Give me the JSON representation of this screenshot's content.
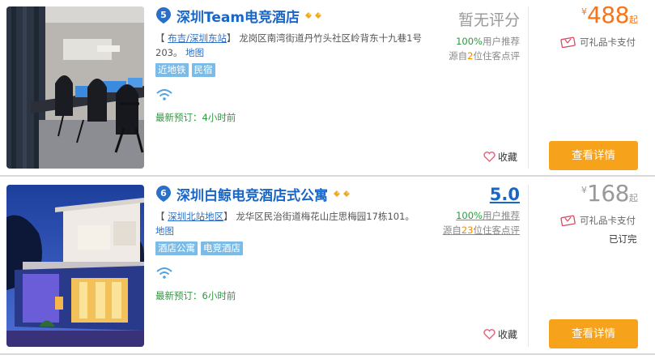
{
  "hotels": [
    {
      "number": "5",
      "name": "深圳Team电竞酒店",
      "address_prefix": "【",
      "area": "布吉/深圳东站",
      "address_suffix": "】",
      "address": "龙岗区南湾街道丹竹头社区岭背东十九巷1号203。",
      "map_label": "地图",
      "tags": [
        "近地铁",
        "民宿"
      ],
      "recent_booking": "最新预订：4小时前",
      "score_text": "暂无评分",
      "recommend_pct": "100%",
      "recommend_text": "用户推荐",
      "reviews_prefix": "源自",
      "reviews_count": "2",
      "reviews_suffix": "位住客点评",
      "favorite_label": "收藏",
      "price_currency": "¥",
      "price": "488",
      "price_suffix": "起",
      "gift_card": "可礼品卡支付",
      "booked": "",
      "detail_button": "查看详情"
    },
    {
      "number": "6",
      "name": "深圳白鲸电竞酒店式公寓",
      "address_prefix": "【",
      "area": "深圳北站地区",
      "address_suffix": "】",
      "address": "龙华区民治街道梅花山庄思梅园17栋101。",
      "map_label": "地图",
      "tags": [
        "酒店公寓",
        "电竞酒店"
      ],
      "recent_booking": "最新预订：6小时前",
      "score_text": "5.0",
      "recommend_pct": "100%",
      "recommend_text": "用户推荐",
      "reviews_prefix": "源自",
      "reviews_count": "23",
      "reviews_suffix": "位住客点评",
      "favorite_label": "收藏",
      "price_currency": "¥",
      "price": "168",
      "price_suffix": "起",
      "gift_card": "可礼品卡支付",
      "booked": "已订完",
      "detail_button": "查看详情"
    }
  ],
  "colors": {
    "title_blue": "#1866c7",
    "price_orange": "#f5761a",
    "button_orange": "#f7a21b",
    "tag_blue": "#7cbbe6",
    "green": "#2b9a3c"
  }
}
